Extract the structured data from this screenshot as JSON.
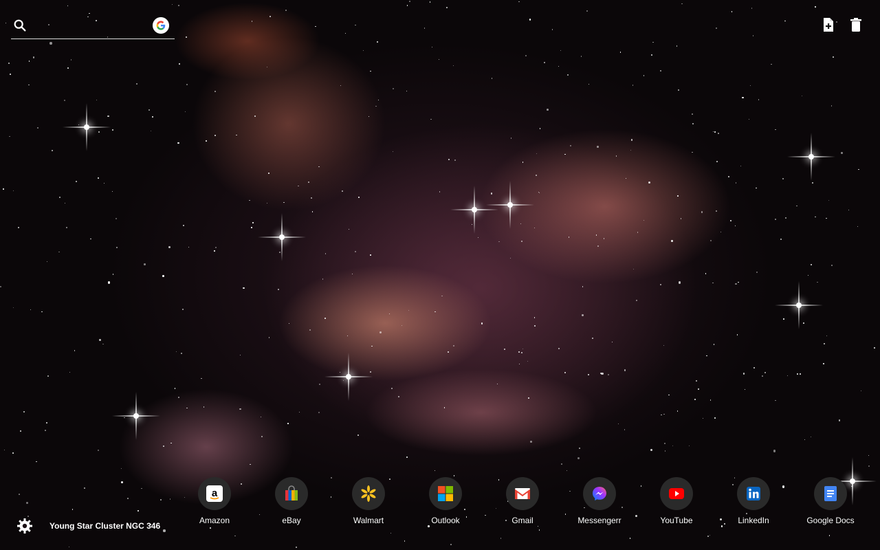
{
  "search": {
    "placeholder": "",
    "value": ""
  },
  "caption": "Young Star Cluster NGC 346",
  "top_actions": [
    {
      "name": "new-note-icon"
    },
    {
      "name": "trash-icon"
    }
  ],
  "shortcuts": [
    {
      "label": "Amazon",
      "icon": "amazon-icon",
      "color": "#000000"
    },
    {
      "label": "eBay",
      "icon": "ebay-icon",
      "color": "#e53238"
    },
    {
      "label": "Walmart",
      "icon": "walmart-icon",
      "color": "#ffc220"
    },
    {
      "label": "Outlook",
      "icon": "outlook-icon",
      "color": "#f25022"
    },
    {
      "label": "Gmail",
      "icon": "gmail-icon",
      "color": "#ea4335"
    },
    {
      "label": "Messengerr",
      "icon": "messenger-icon",
      "color": "#0084ff"
    },
    {
      "label": "YouTube",
      "icon": "youtube-icon",
      "color": "#ff0000"
    },
    {
      "label": "LinkedIn",
      "icon": "linkedin-icon",
      "color": "#0a66c2"
    },
    {
      "label": "Google Docs",
      "icon": "google-docs-icon",
      "color": "#4285f4"
    }
  ]
}
